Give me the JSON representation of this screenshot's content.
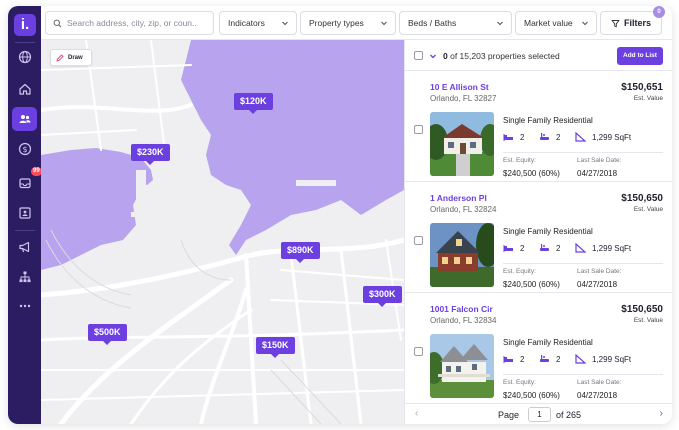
{
  "app": {
    "logo_letter": "i."
  },
  "sidebar": {
    "items": [
      {
        "icon": "globe-icon"
      },
      {
        "icon": "home-icon"
      },
      {
        "icon": "users-icon",
        "active": true
      },
      {
        "icon": "dollar-icon"
      },
      {
        "icon": "inbox-icon",
        "badge": "99"
      },
      {
        "icon": "contact-card-icon"
      },
      {
        "icon": "megaphone-icon"
      },
      {
        "icon": "org-chart-icon"
      },
      {
        "icon": "more-icon"
      }
    ]
  },
  "topbar": {
    "search_placeholder": "Search address, city, zip, or coun...",
    "dropdowns": [
      "Indicators",
      "Property types",
      "Beds / Baths",
      "Market value"
    ],
    "filters_label": "Filters",
    "filters_count": "0"
  },
  "map": {
    "draw_label": "Draw",
    "pins": [
      "$120K",
      "$230K",
      "$890K",
      "$300K",
      "$500K",
      "$150K"
    ],
    "colors": {
      "water": "#b8a3ee",
      "land": "#efeff1",
      "road": "#ffffff",
      "accent": "#6c3fe0"
    }
  },
  "list": {
    "selected_count": "0",
    "selected_text": "of 15,203 properties selected",
    "add_to_list_label": "Add to List",
    "properties": [
      {
        "address": "10 E Allison St",
        "city": "Orlando, FL 32827",
        "price": "$150,651",
        "price_label": "Est. Value",
        "type": "Single Family Residential",
        "beds": "2",
        "baths": "2",
        "sqft": "1,299 SqFt",
        "equity_label": "Est. Equity:",
        "equity": "$240,500 (60%)",
        "last_sale_label": "Last Sale Date:",
        "last_sale": "04/27/2018"
      },
      {
        "address": "1 Anderson Pl",
        "city": "Orlando, FL 32824",
        "price": "$150,650",
        "price_label": "Est. Value",
        "type": "Single Family Residential",
        "beds": "2",
        "baths": "2",
        "sqft": "1,299 SqFt",
        "equity_label": "Est. Equity:",
        "equity": "$240,500 (60%)",
        "last_sale_label": "Last Sale Date:",
        "last_sale": "04/27/2018"
      },
      {
        "address": "1001 Falcon Cir",
        "city": "Orlando, FL 32834",
        "price": "$150,650",
        "price_label": "Est. Value",
        "type": "Single Family Residential",
        "beds": "2",
        "baths": "2",
        "sqft": "1,299 SqFt",
        "equity_label": "Est. Equity:",
        "equity": "$240,500 (60%)",
        "last_sale_label": "Last Sale Date:",
        "last_sale": "04/27/2018"
      }
    ]
  },
  "pager": {
    "page_label": "Page",
    "current": "1",
    "of_label": "of 265"
  }
}
